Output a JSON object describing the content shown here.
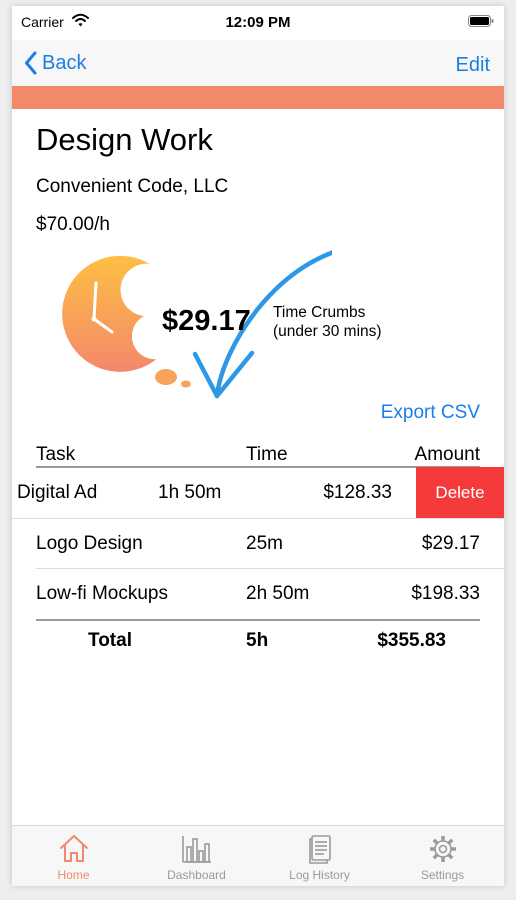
{
  "status_bar": {
    "carrier": "Carrier",
    "time": "12:09 PM"
  },
  "nav": {
    "back_label": "Back",
    "edit_label": "Edit"
  },
  "colors": {
    "accent": "#f4886a",
    "link": "#1a7ee8",
    "delete": "#f43a3a",
    "clock_top": "#fdbf44",
    "clock_bottom": "#f4886a"
  },
  "project": {
    "title": "Design Work",
    "client": "Convenient Code, LLC",
    "rate": "$70.00/h"
  },
  "time_crumbs": {
    "amount": "$29.17",
    "label_line1": "Time Crumbs",
    "label_line2": "(under 30 mins)"
  },
  "actions": {
    "export_label": "Export CSV"
  },
  "table": {
    "headers": {
      "task": "Task",
      "time": "Time",
      "amount": "Amount"
    },
    "rows": [
      {
        "task": "Digital Ad",
        "time": "1h 50m",
        "amount": "$128.33",
        "swipe_action": "Delete"
      },
      {
        "task": "Logo Design",
        "time": "25m",
        "amount": "$29.17"
      },
      {
        "task": "Low-fi Mockups",
        "time": "2h 50m",
        "amount": "$198.33"
      }
    ],
    "total": {
      "label": "Total",
      "time": "5h",
      "amount": "$355.83"
    }
  },
  "tabs": [
    {
      "label": "Home",
      "icon": "home-icon",
      "active": true
    },
    {
      "label": "Dashboard",
      "icon": "bar-chart-icon",
      "active": false
    },
    {
      "label": "Log History",
      "icon": "document-icon",
      "active": false
    },
    {
      "label": "Settings",
      "icon": "gear-icon",
      "active": false
    }
  ]
}
